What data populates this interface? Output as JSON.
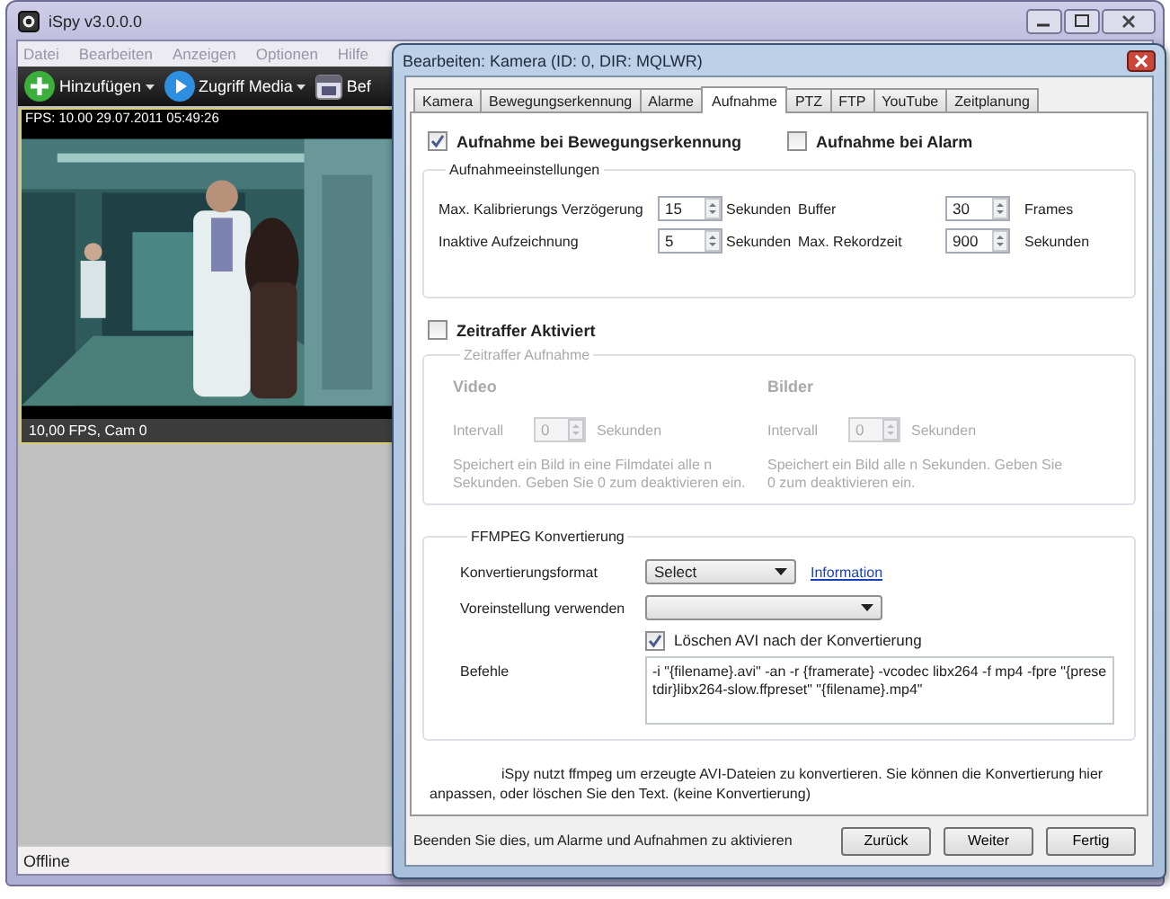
{
  "main_window": {
    "title": "iSpy v3.0.0.0",
    "menu": [
      "Datei",
      "Bearbeiten",
      "Anzeigen",
      "Optionen",
      "Hilfe"
    ],
    "toolbar": [
      {
        "label": "Hinzufügen",
        "dropdown": true
      },
      {
        "label": "Zugriff Media",
        "dropdown": true
      },
      {
        "label": "Bef",
        "dropdown": false
      }
    ],
    "camera": {
      "overlay_top": "FPS: 10.00 29.07.2011 05:49:26",
      "overlay_bottom": "10,00 FPS, Cam 0"
    },
    "status_bar": "Offline"
  },
  "dialog": {
    "title": "Bearbeiten: Kamera (ID: 0, DIR: MQLWR)",
    "tabs": [
      {
        "label": "Kamera",
        "selected": false
      },
      {
        "label": "Bewegungserkennung",
        "selected": false
      },
      {
        "label": "Alarme",
        "selected": false
      },
      {
        "label": "Aufnahme",
        "selected": true
      },
      {
        "label": "PTZ",
        "selected": false
      },
      {
        "label": "FTP",
        "selected": false
      },
      {
        "label": "YouTube",
        "selected": false
      },
      {
        "label": "Zeitplanung",
        "selected": false
      }
    ],
    "record_on_motion": {
      "label": "Aufnahme bei Bewegungserkennung",
      "checked": true
    },
    "record_on_alarm": {
      "label": "Aufnahme bei Alarm",
      "checked": false
    },
    "recording_settings": {
      "title": "Aufnahmeeinstellungen",
      "fields": [
        {
          "label": "Max. Kalibrierungs Verzögerung",
          "value": "15",
          "unit": "Sekunden"
        },
        {
          "label": "Buffer",
          "value": "30",
          "unit": "Frames"
        },
        {
          "label": "Inaktive Aufzeichnung",
          "value": "5",
          "unit": "Sekunden"
        },
        {
          "label": "Max. Rekordzeit",
          "value": "900",
          "unit": "Sekunden"
        }
      ]
    },
    "timelapse": {
      "label": "Zeitraffer Aktiviert",
      "checked": false,
      "group_title": "Zeitraffer Aufnahme",
      "columns": [
        {
          "heading": "Video",
          "interval_label": "Intervall",
          "value": "0",
          "unit": "Sekunden",
          "description": "Speichert ein Bild in eine Filmdatei alle n Sekunden. Geben Sie 0 zum deaktivieren ein."
        },
        {
          "heading": "Bilder",
          "interval_label": "Intervall",
          "value": "0",
          "unit": "Sekunden",
          "description": "Speichert ein Bild alle n Sekunden. Geben Sie 0 zum deaktivieren ein."
        }
      ]
    },
    "ffmpeg": {
      "title": "FFMPEG Konvertierung",
      "format_label": "Konvertierungsformat",
      "format_value": "Select",
      "info_link": "Information",
      "preset_label": "Voreinstellung verwenden",
      "delete_avi": {
        "label": "Löschen AVI nach der Konvertierung",
        "checked": true
      },
      "commands_label": "Befehle",
      "commands": "-i \"{filename}.avi\" -an -r {framerate} -vcodec libx264 -f mp4 -fpre \"{presetdir}libx264-slow.ffpreset\" \"{filename}.mp4\""
    },
    "note": "iSpy nutzt ffmpeg um erzeugte AVI-Dateien zu konvertieren. Sie können die Konvertierung hier anpassen, oder löschen Sie den Text. (keine Konvertierung)",
    "footer_hint": "Beenden Sie dies, um Alarme und Aufnahmen zu aktivieren",
    "buttons": [
      "Zurück",
      "Weiter",
      "Fertig"
    ]
  }
}
